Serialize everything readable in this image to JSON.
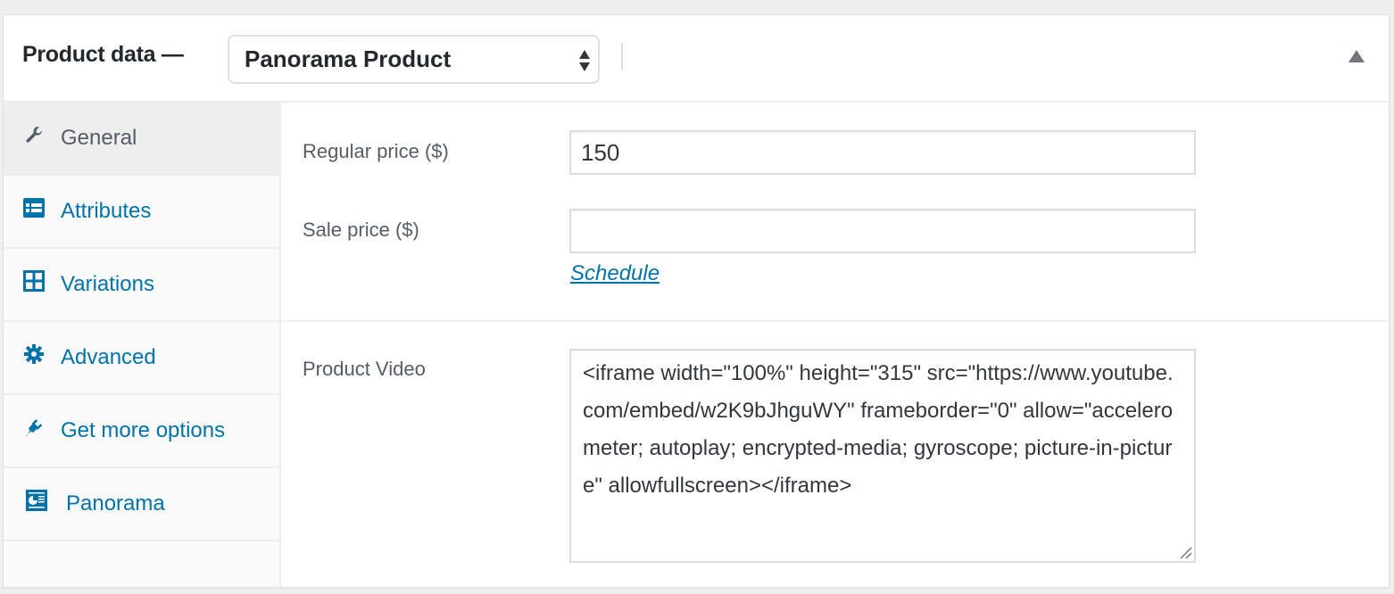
{
  "header": {
    "title": "Product data —",
    "product_type": {
      "selected": "Panorama Product"
    },
    "toggle_icon": "triangle-up-icon"
  },
  "tabs": [
    {
      "label": "General",
      "icon": "wrench-icon",
      "active": true
    },
    {
      "label": "Attributes",
      "icon": "list-card-icon",
      "active": false
    },
    {
      "label": "Variations",
      "icon": "grid-icon",
      "active": false
    },
    {
      "label": "Advanced",
      "icon": "gear-icon",
      "active": false
    },
    {
      "label": "Get more options",
      "icon": "plug-icon",
      "active": false
    },
    {
      "label": "Panorama",
      "icon": "panorama-icon",
      "active": false
    }
  ],
  "general": {
    "regular_price": {
      "label": "Regular price ($)",
      "value": "150"
    },
    "sale_price": {
      "label": "Sale price ($)",
      "value": ""
    },
    "schedule_link": "Schedule",
    "product_video": {
      "label": "Product Video",
      "value": "<iframe width=\"100%\" height=\"315\" src=\"https://www.youtube.com/embed/w2K9bJhguWY\" frameborder=\"0\" allow=\"accelerometer; autoplay; encrypted-media; gyroscope; picture-in-picture\" allowfullscreen></iframe>"
    }
  },
  "colors": {
    "link": "#0073aa",
    "active_tab_bg": "#eeeeee",
    "text": "#23282d",
    "muted_text": "#555d66"
  }
}
